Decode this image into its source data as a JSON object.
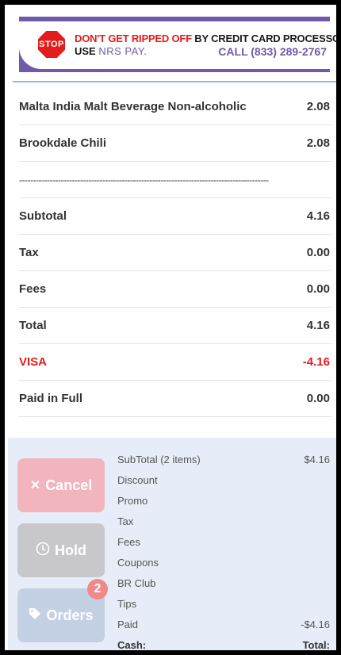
{
  "banner": {
    "stop": "STOP",
    "warn_red": "DON'T GET RIPPED OFF",
    "warn_dark": " BY CREDIT CARD PROCESSORS!",
    "use": "USE ",
    "brand": "NRS PAY.",
    "call": "CALL (833) 289-2767"
  },
  "receipt": {
    "items": [
      {
        "label": "Malta India Malt Beverage Non-alcoholic",
        "value": "2.08"
      },
      {
        "label": "Brookdale Chili",
        "value": "2.08"
      }
    ],
    "divider": "------------------------------------------------------------------------------------------",
    "totals": [
      {
        "label": "Subtotal",
        "value": "4.16"
      },
      {
        "label": "Tax",
        "value": "0.00"
      },
      {
        "label": "Fees",
        "value": "0.00"
      },
      {
        "label": "Total",
        "value": "4.16"
      }
    ],
    "payment": {
      "label": "VISA",
      "value": "-4.16"
    },
    "paid": {
      "label": "Paid in Full",
      "value": "0.00"
    }
  },
  "buttons": {
    "cancel": "Cancel",
    "hold": "Hold",
    "orders": "Orders",
    "orders_badge": "2"
  },
  "summary": {
    "subtotal_label": "SubTotal (2 items)",
    "subtotal_value": "$4.16",
    "discount": "Discount",
    "promo": "Promo",
    "tax": "Tax",
    "fees": "Fees",
    "coupons": "Coupons",
    "br_club": "BR Club",
    "tips": "Tips",
    "paid_label": "Paid",
    "paid_value": "-$4.16",
    "cash_label": "Cash:",
    "total_label": "Total:"
  },
  "colors": {
    "accent_red": "#e41c1c",
    "brand_purple": "#6f5aa8",
    "panel_bg": "#e6edf8"
  }
}
